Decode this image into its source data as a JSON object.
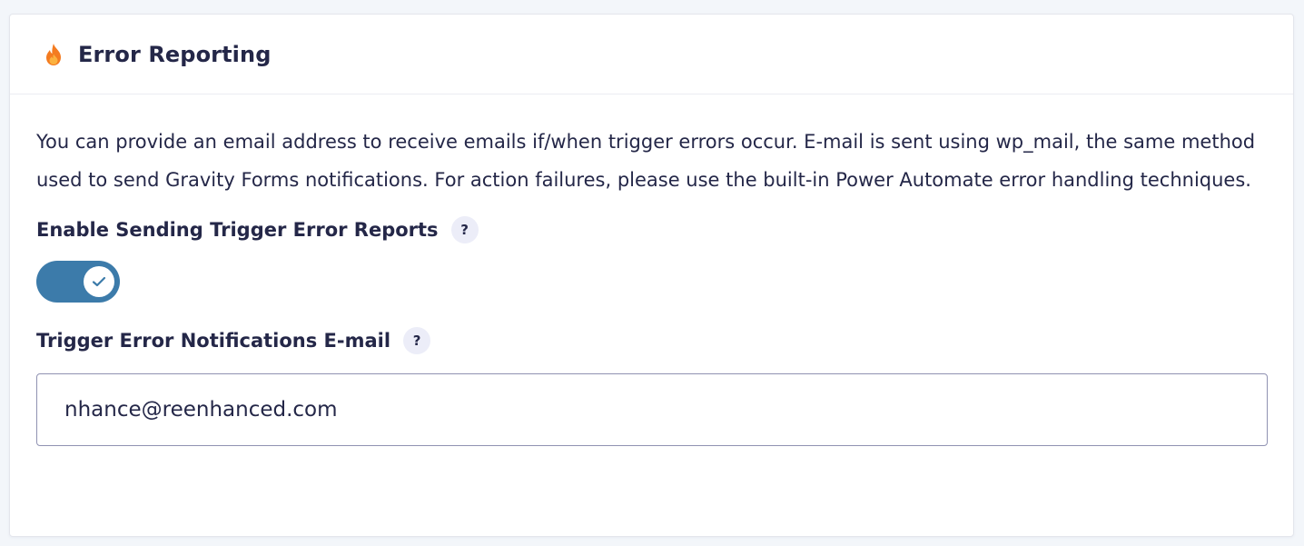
{
  "panel": {
    "title": "Error Reporting",
    "icon": "flame-icon"
  },
  "description": "You can provide an email address to receive emails if/when trigger errors occur. E-mail is sent using wp_mail, the same method used to send Gravity Forms notifications. For action failures, please use the built-in Power Automate error handling techniques.",
  "enable_reports": {
    "label": "Enable Sending Trigger Error Reports",
    "help": "?",
    "enabled": true
  },
  "notification_email": {
    "label": "Trigger Error Notifications E-mail",
    "help": "?",
    "value": "nhance@reenhanced.com"
  },
  "colors": {
    "toggle_on": "#3c7baa",
    "text": "#242748",
    "help_bg": "#ecedf8"
  }
}
